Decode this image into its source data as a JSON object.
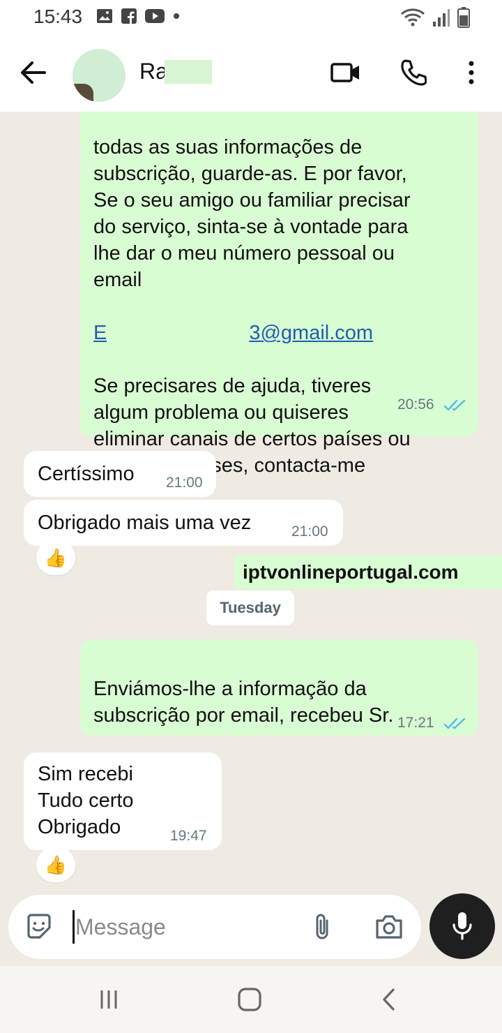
{
  "status_bar": {
    "time": "15:43",
    "left_icons": [
      "gallery-icon",
      "facebook-icon",
      "youtube-icon",
      "dot-icon"
    ],
    "right_icons": [
      "wifi-icon",
      "signal-icon",
      "battery-icon"
    ]
  },
  "header": {
    "contact_name_visible": "Ra",
    "icons": [
      "back-arrow-icon",
      "video-call-icon",
      "phone-icon",
      "more-vert-icon"
    ]
  },
  "messages": [
    {
      "direction": "out",
      "lines_before_email": "todas as suas informações de\nsubscrição, guarde-as. E por favor,\nSe o seu amigo ou familiar precisar\ndo serviço, sinta-se à vontade para\nlhe dar o meu número pessoal ou\nemail",
      "email_start": "E",
      "email_end": "3@gmail.com",
      "lines_after_email": "Se precisares de ajuda, tiveres\nalgum problema ou quiseres\neliminar canais de certos países ou\norganizar países, contacta-me",
      "time": "20:56",
      "status": "read"
    },
    {
      "direction": "in",
      "text": "Certíssimo",
      "time": "21:00"
    },
    {
      "direction": "in",
      "text": "Obrigado mais uma vez",
      "time": "21:00",
      "reaction": "👍"
    },
    {
      "direction": "out",
      "text": "Enviámos-lhe a informação da\nsubscrição por email, recebeu Sr.",
      "text_end": "?",
      "time": "17:21",
      "status": "read"
    },
    {
      "direction": "in",
      "text": "Sim recebi\nTudo certo\nObrigado",
      "time": "19:47",
      "reaction": "👍"
    }
  ],
  "watermark": "iptvonlineportugal.com",
  "day_divider": "Tuesday",
  "composer": {
    "placeholder": "Message",
    "value": "",
    "icons": [
      "sticker-icon",
      "attach-icon",
      "camera-icon",
      "mic-icon"
    ]
  },
  "nav_bar": {
    "icons": [
      "recents-icon",
      "home-icon",
      "back-icon"
    ]
  },
  "colors": {
    "outgoing_bubble": "#d9fdd3",
    "incoming_bubble": "#ffffff",
    "chat_background": "#efeae2",
    "read_ticks": "#53bdeb",
    "link": "#1f5fae"
  }
}
